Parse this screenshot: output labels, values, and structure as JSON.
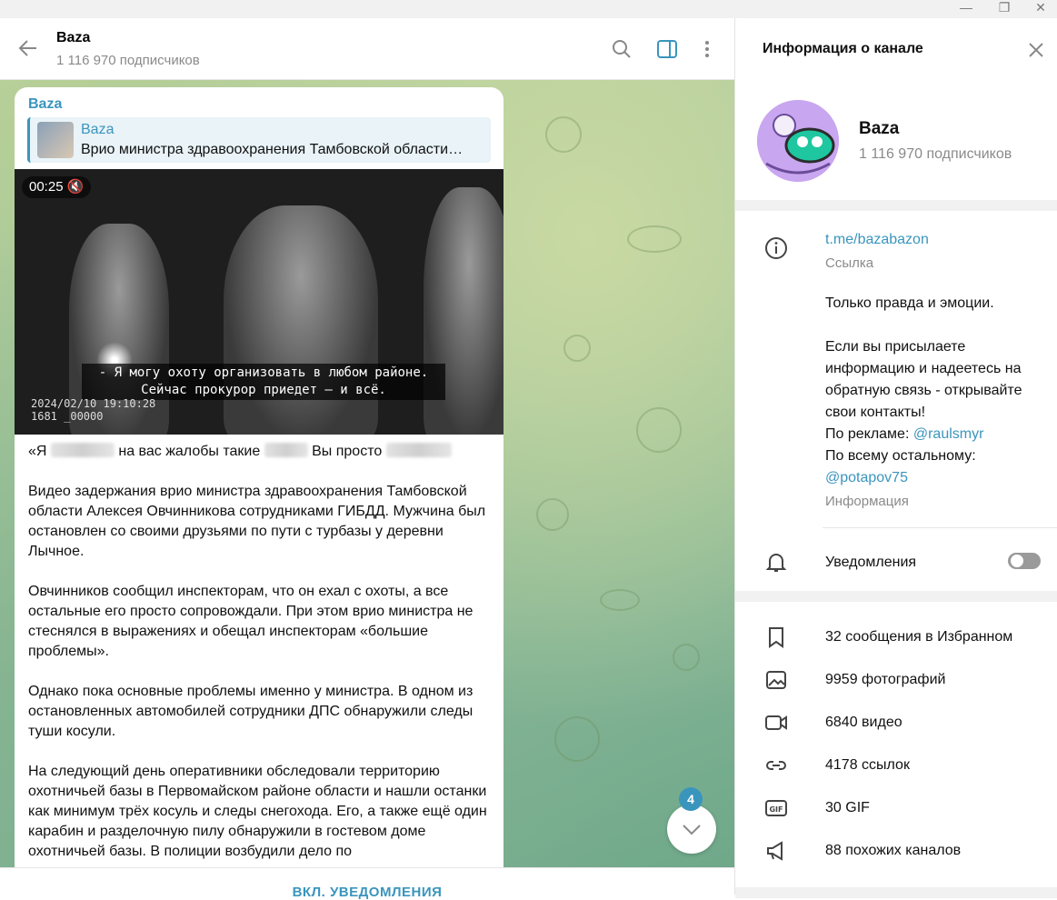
{
  "chat": {
    "title": "Baza",
    "subtitle": "1 116 970 подписчиков"
  },
  "message": {
    "author": "Baza",
    "reply_author": "Baza",
    "reply_text": "Врио министра здравоохранения Тамбовской области…",
    "video_time": "00:25",
    "video_subtitle_1": "- Я могу охоту организовать в любом районе.",
    "video_subtitle_2": "Сейчас прокурор приедет — и всё.",
    "video_stamp_1": "2024/02/10 19:10:28",
    "video_stamp_2": "1681   _00000",
    "quote_1": "«Я",
    "quote_2": "на вас жалобы такие",
    "quote_3": "Вы просто",
    "paragraph_1": "Видео задержания врио министра здравоохранения Тамбовской области Алексея Овчинникова сотрудниками ГИБДД. Мужчина был остановлен со своими друзьями по пути с турбазы у деревни Лычное.",
    "paragraph_2": "Овчинников сообщил инспекторам, что он ехал с охоты, а все остальные его просто сопровождали. При этом врио министра не стеснялся в выражениях и обещал инспекторам «большие проблемы».",
    "paragraph_3": "Однако пока основные проблемы именно у министра. В одном из остановленных автомобилей сотрудники ДПС обнаружили следы туши косули.",
    "paragraph_4": "На следующий день оперативники обследовали территорию охотничьей базы в Первомайском районе области и нашли останки как минимум трёх косуль и следы снегохода. Его, а также ещё один карабин и разделочную пилу обнаружили в гостевом доме охотничьей базы. В полиции возбудили дело по"
  },
  "scroll_badge": "4",
  "bottom_action": "ВКЛ. УВЕДОМЛЕНИЯ",
  "panel": {
    "title": "Информация о канале",
    "channel_name": "Baza",
    "channel_sub": "1 116 970 подписчиков",
    "link": "t.me/bazabazon",
    "link_caption": "Ссылка",
    "desc_1": "Только правда и эмоции.",
    "desc_2": "Если вы присылаете информацию и надеетесь на обратную связь - открывайте свои контакты!",
    "desc_3_prefix": "По рекламе: ",
    "desc_3_link": "@raulsmyr",
    "desc_4": "По всему остальному:",
    "desc_5_link": "@potapov75",
    "desc_caption": "Информация",
    "notifications": "Уведомления",
    "stats": [
      "32 сообщения в Избранном",
      "9959 фотографий",
      "6840 видео",
      "4178 ссылок",
      "30 GIF",
      "88 похожих каналов"
    ]
  },
  "icons": [
    "back-arrow-icon",
    "search-icon",
    "sidebar-toggle-icon",
    "more-vert-icon",
    "mute-icon",
    "chevron-down-icon",
    "close-icon",
    "info-icon",
    "bell-icon",
    "bookmark-icon",
    "photo-icon",
    "video-icon",
    "link-icon",
    "gif-icon",
    "megaphone-icon"
  ],
  "colors": {
    "accent": "#3a95bd",
    "muted": "#8a8a8a"
  }
}
